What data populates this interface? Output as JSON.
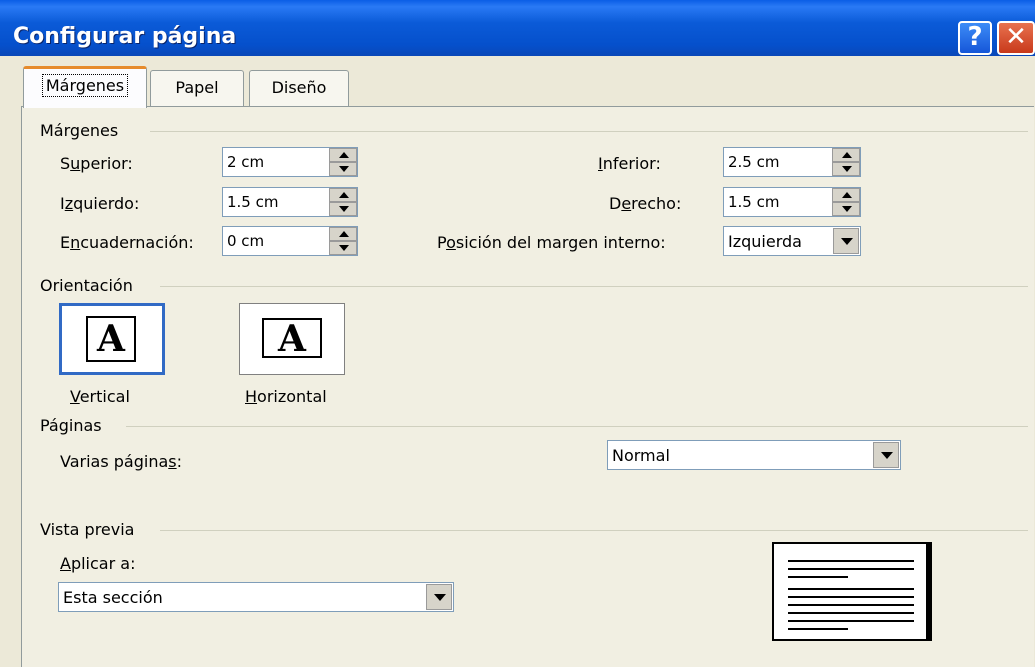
{
  "window": {
    "title": "Configurar página",
    "help_glyph": "?",
    "close_glyph": "✕"
  },
  "tabs": [
    {
      "label": "Márgenes",
      "active": true
    },
    {
      "label": "Papel",
      "active": false
    },
    {
      "label": "Diseño",
      "active": false
    }
  ],
  "margins": {
    "group_title": "Márgenes",
    "top": {
      "label_pre": "S",
      "label_u": "u",
      "label_post": "perior:",
      "value": "2 cm"
    },
    "left": {
      "label_pre": "I",
      "label_u": "z",
      "label_post": "quierdo:",
      "value": "1.5 cm"
    },
    "gutter": {
      "label_pre": "E",
      "label_u": "n",
      "label_post": "cuadernación:",
      "value": "0 cm"
    },
    "bottom": {
      "label_pre": "",
      "label_u": "I",
      "label_post": "nferior:",
      "value": "2.5 cm"
    },
    "right": {
      "label_pre": "D",
      "label_u": "e",
      "label_post": "recho:",
      "value": "1.5 cm"
    },
    "gutter_pos": {
      "label_pre": "P",
      "label_u": "o",
      "label_post": "sición del margen interno:",
      "value": "Izquierda"
    }
  },
  "orientation": {
    "group_title": "Orientación",
    "vertical": {
      "label_u": "V",
      "label_post": "ertical",
      "selected": true,
      "glyph": "A"
    },
    "horizontal": {
      "label_u": "H",
      "label_post": "orizontal",
      "selected": false,
      "glyph": "A"
    }
  },
  "pages": {
    "group_title": "Páginas",
    "multi_label_pre": "Varias página",
    "multi_label_u": "s",
    "multi_label_post": ":",
    "multi_value": "Normal"
  },
  "preview": {
    "group_title": "Vista previa",
    "apply_label_u": "A",
    "apply_label_post": "plicar a:",
    "apply_value": "Esta sección"
  }
}
